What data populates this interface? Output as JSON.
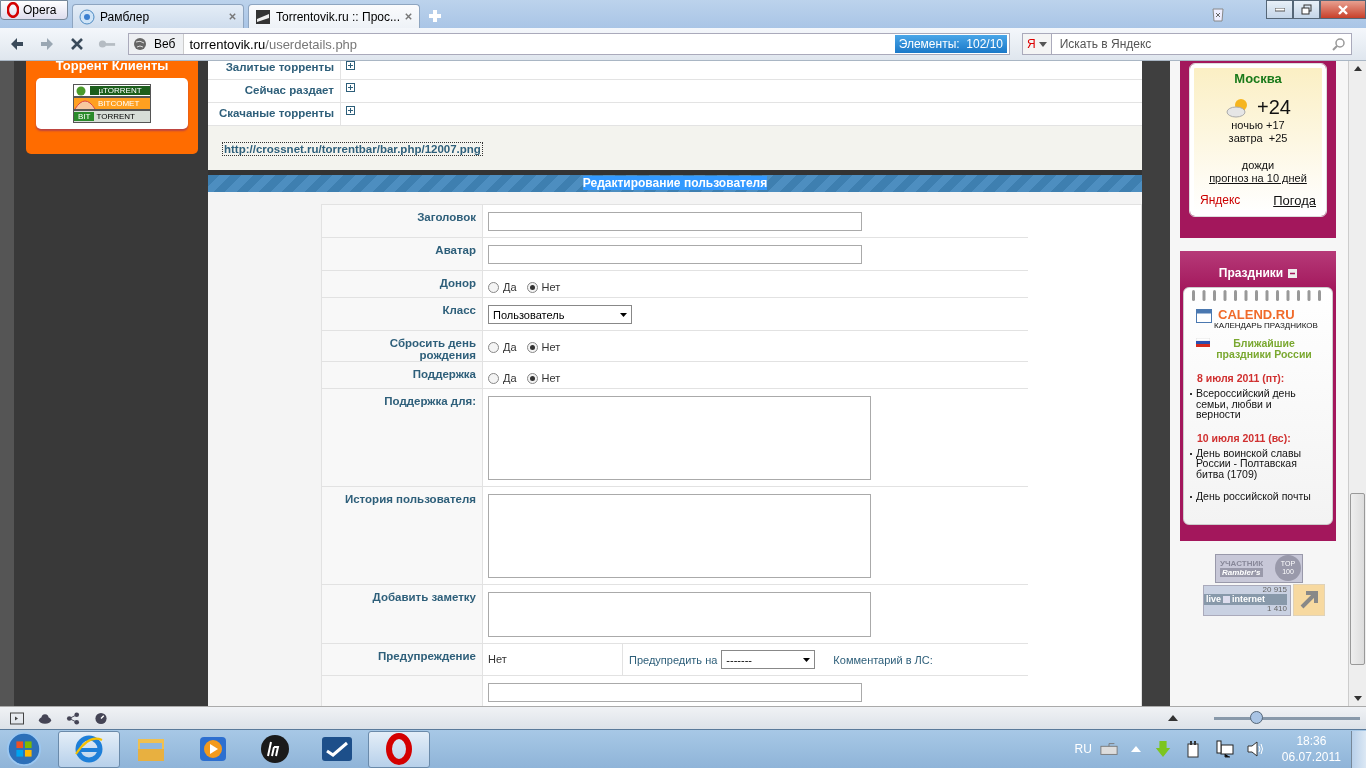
{
  "browser": {
    "menu_button": "Opera",
    "tabs": [
      {
        "title": "Рамблер",
        "selected": false
      },
      {
        "title": "Torrentovik.ru :: Прос...",
        "selected": true
      }
    ],
    "address": {
      "mode": "Веб",
      "host": "torrentovik.ru",
      "path": "/userdetails.php",
      "elements_badge": "Элементы:  102/10"
    },
    "search": {
      "engine": "Я",
      "placeholder": "Искать в Яндекс"
    }
  },
  "sidebar_left": {
    "title": "Торрент Клиенты",
    "clients": [
      {
        "kind": "utorrent",
        "label": "µTORRENT"
      },
      {
        "kind": "bitcomet",
        "label": "BITCOMET"
      },
      {
        "kind": "bittorrent",
        "prefix": "BIT",
        "label": "TORRENT"
      }
    ]
  },
  "stats_rows": [
    {
      "label": "Залитые торренты",
      "expanded": false
    },
    {
      "label": "Сейчас раздает",
      "expanded": false
    },
    {
      "label": "Скачаные торренты",
      "expanded": false
    }
  ],
  "userbar_link": "http://crossnet.ru/torrentbar/bar.php/12007.png",
  "edit_form": {
    "title": "Редактирование пользователя",
    "rows": [
      {
        "kind": "text",
        "label": "Заголовок"
      },
      {
        "kind": "text",
        "label": "Аватар"
      },
      {
        "kind": "radio",
        "label": "Донор",
        "options": [
          {
            "label": "Да",
            "selected": false
          },
          {
            "label": "Нет",
            "selected": true
          }
        ]
      },
      {
        "kind": "select",
        "label": "Класс",
        "value": "Пользователь"
      },
      {
        "kind": "radio",
        "label": "Сбросить день рождения",
        "options": [
          {
            "label": "Да",
            "selected": false
          },
          {
            "label": "Нет",
            "selected": true
          }
        ]
      },
      {
        "kind": "radio",
        "label": "Поддержка",
        "options": [
          {
            "label": "Да",
            "selected": false
          },
          {
            "label": "Нет",
            "selected": true
          }
        ]
      },
      {
        "kind": "textarea",
        "label": "Поддержка для:"
      },
      {
        "kind": "textarea",
        "label": "История пользователя"
      },
      {
        "kind": "note",
        "label": "Добавить заметку"
      },
      {
        "kind": "warning",
        "label": "Предупреждение",
        "status": "Нет",
        "warn_label": "Предупредить на",
        "warn_value": "-------",
        "comment_label": "Комментарий в ЛС:"
      },
      {
        "kind": "text"
      }
    ]
  },
  "weather": {
    "city": "Москва",
    "temp": "+24",
    "night": "ночью +17",
    "tomorrow": "завтра  +25",
    "condition": "дожди",
    "forecast_link": "прогноз на 10 дней",
    "brand": "Яндекс",
    "brand_link": "Погода"
  },
  "holidays": {
    "title": "Праздники",
    "expanded": true,
    "brand": "CALEND.RU",
    "subtitle": "КАЛЕНДАРЬ ПРАЗДНИКОВ",
    "heading": "Ближайшие праздники России",
    "days": [
      {
        "date": "8 июля 2011 (пт):",
        "items": [
          "Всероссийский день семьи, любви и верности"
        ]
      },
      {
        "date": "10 июля 2011 (вс):",
        "items": [
          "День воинской славы России - Полтавская битва (1709)",
          "День российской почты"
        ]
      }
    ]
  },
  "counters": {
    "rambler": [
      "УЧАСТНИК",
      "Rambler's",
      "TOP",
      "100"
    ],
    "liveinternet": [
      "20 915",
      "live",
      "internet",
      "1 410"
    ]
  },
  "status_bar": {
    "zoom": {
      "level": 0.29
    }
  },
  "taskbar": {
    "apps": [
      {
        "kind": "ie",
        "active": true
      },
      {
        "kind": "explorer",
        "active": false
      },
      {
        "kind": "media",
        "active": false
      },
      {
        "kind": "hp",
        "active": false
      },
      {
        "kind": "check",
        "active": false
      },
      {
        "kind": "opera",
        "active": true
      }
    ],
    "language": "RU",
    "time": "18:36",
    "date": "06.07.2011"
  }
}
